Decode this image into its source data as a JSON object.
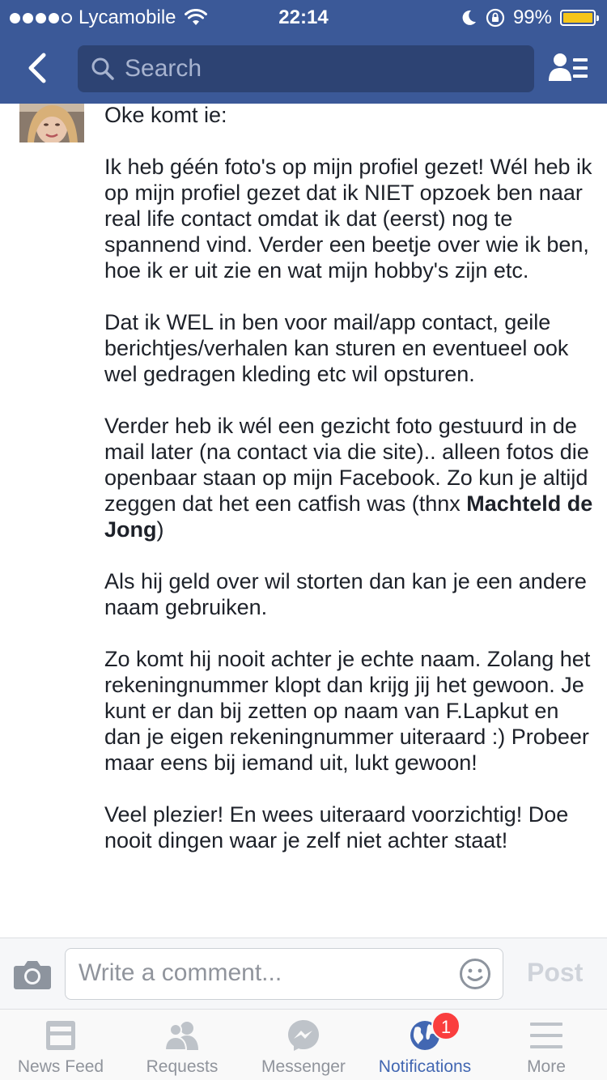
{
  "status_bar": {
    "carrier": "Lycamobile",
    "time": "22:14",
    "battery": "99%",
    "battery_level": 0.99,
    "signal_bars": 4,
    "signal_max": 5
  },
  "nav": {
    "search_placeholder": "Search"
  },
  "post": {
    "paragraphs": [
      "Oke komt ie:",
      "Ik heb géén foto's op mijn profiel gezet! Wél heb ik op mijn profiel gezet dat ik NIET opzoek ben naar real life contact omdat ik dat (eerst) nog te spannend vind. Verder een beetje over wie ik ben, hoe ik er uit zie en wat mijn hobby's zijn etc.",
      "Dat ik WEL in ben voor mail/app contact, geile berichtjes/verhalen kan sturen en eventueel ook wel gedragen kleding etc wil opsturen.",
      "Verder heb ik wél een gezicht foto gestuurd in de mail later (na contact via die site).. alleen fotos die openbaar staan op mijn Facebook. Zo kun je altijd zeggen dat het een catfish was (thnx ",
      "Als hij geld over wil storten dan kan je een andere naam gebruiken.",
      "Zo komt hij nooit achter je echte naam. Zolang het rekeningnummer klopt dan krijg jij het gewoon. Je kunt er dan bij zetten op naam van F.Lapkut en dan je eigen rekeningnummer uiteraard :) Probeer maar eens bij iemand uit, lukt gewoon!",
      "Veel plezier! En wees uiteraard voorzichtig! Doe nooit dingen waar je zelf niet achter staat!"
    ],
    "mention": "Machteld de Jong",
    "mention_suffix": ")"
  },
  "comment_bar": {
    "placeholder": "Write a comment...",
    "post_label": "Post"
  },
  "tabs": [
    {
      "label": "News Feed",
      "icon": "news-feed-icon"
    },
    {
      "label": "Requests",
      "icon": "friend-requests-icon"
    },
    {
      "label": "Messenger",
      "icon": "messenger-icon"
    },
    {
      "label": "Notifications",
      "icon": "globe-icon",
      "active": true,
      "badge": "1"
    },
    {
      "label": "More",
      "icon": "hamburger-menu-icon"
    }
  ],
  "colors": {
    "brand": "#3b5998",
    "active_tab": "#4267b2",
    "badge": "#fa3e3e"
  }
}
